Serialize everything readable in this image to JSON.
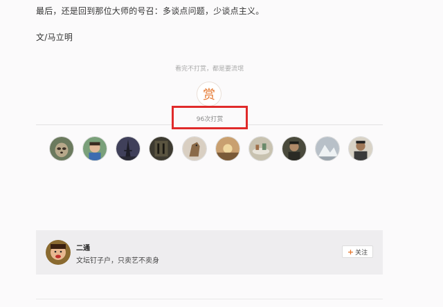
{
  "article": {
    "closing_line": "最后，还是回到那位大师的号召：多谈点问题，少谈点主义。",
    "author_line": "文/马立明"
  },
  "reward": {
    "hint": "看完不打赏，都是要流氓",
    "button_label": "赏",
    "count_text": "96次打赏"
  },
  "supporters": [
    {
      "name": "supporter-1",
      "icon": "sloth-avatar",
      "color": "#6b7a5e"
    },
    {
      "name": "supporter-2",
      "icon": "child-avatar",
      "color": "#7aa07a"
    },
    {
      "name": "supporter-3",
      "icon": "tower-avatar",
      "color": "#40405a"
    },
    {
      "name": "supporter-4",
      "icon": "calligraphy-avatar",
      "color": "#3d3a30"
    },
    {
      "name": "supporter-5",
      "icon": "horse-avatar",
      "color": "#8a6a48"
    },
    {
      "name": "supporter-6",
      "icon": "sunset-avatar",
      "color": "#c9a070"
    },
    {
      "name": "supporter-7",
      "icon": "table-avatar",
      "color": "#c8c2b0"
    },
    {
      "name": "supporter-8",
      "icon": "man-avatar",
      "color": "#4a4a3c"
    },
    {
      "name": "supporter-9",
      "icon": "snow-avatar",
      "color": "#b8c0c8"
    },
    {
      "name": "supporter-10",
      "icon": "portrait-avatar",
      "color": "#6a5a4a"
    }
  ],
  "author_card": {
    "name": "二通",
    "bio": "文坛钉子户，只卖艺不卖身",
    "follow_label": "关注",
    "follow_icon": "plus-icon"
  },
  "colors": {
    "accent": "#e4762d",
    "highlight": "#e02a2a",
    "card_bg": "#eeedef"
  }
}
